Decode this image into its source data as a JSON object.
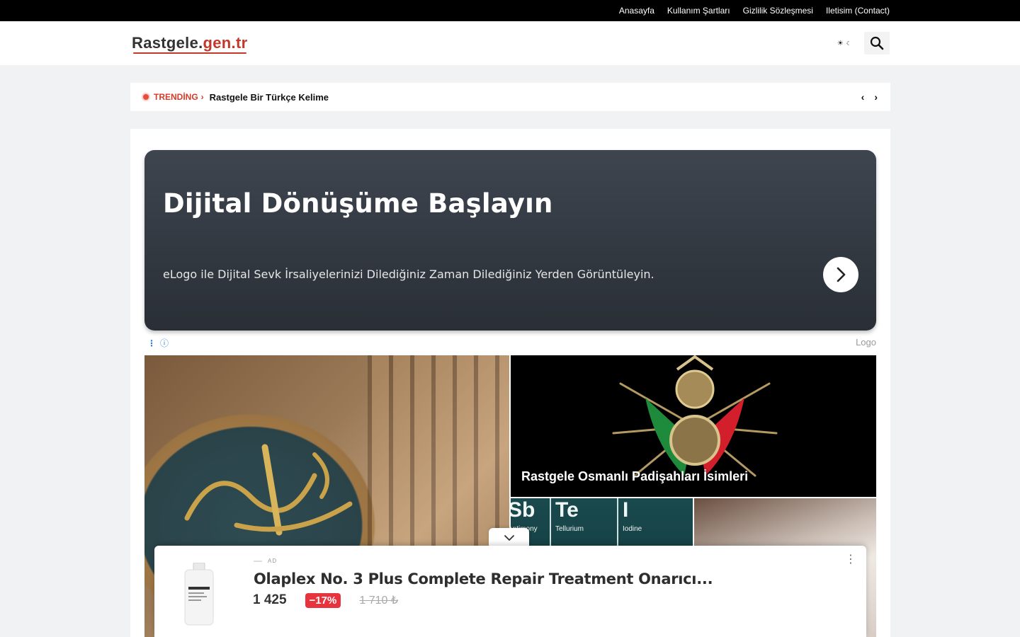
{
  "topnav": {
    "items": [
      "Anasayfa",
      "Kullanım Şartları",
      "Gizlilik Sözleşmesi",
      "Iletisim (Contact)"
    ]
  },
  "header": {
    "logo_part1": "Rastgele.",
    "logo_part2": "gen.tr"
  },
  "trending": {
    "label": "TRENDİNG",
    "title": "Rastgele Bir Türkçe Kelime"
  },
  "ad_banner": {
    "title": "Dijital Dönüşüme Başlayın",
    "subtitle": "eLogo ile Dijital Sevk İrsaliyelerinizi Dilediğiniz Zaman Dilediğiniz Yerden Görüntüleyin.",
    "brand": "Logo"
  },
  "posts": {
    "featured_right": "Rastgele Osmanlı Padişahları İsimleri",
    "elements": [
      {
        "sym": "Sb",
        "name": "Antimony"
      },
      {
        "sym": "Te",
        "name": "Tellurium"
      },
      {
        "sym": "I",
        "name": "Iodine"
      }
    ]
  },
  "bottom_ad": {
    "tag": "AD",
    "product_title": "Olaplex No. 3 Plus Complete Repair Treatment Onarıcı...",
    "price": "1 425",
    "discount": "−17%",
    "old_price": "1 710 ₺"
  },
  "colors": {
    "accent": "#c0392b",
    "trending": "#d63a27",
    "discount": "#e8323c"
  }
}
